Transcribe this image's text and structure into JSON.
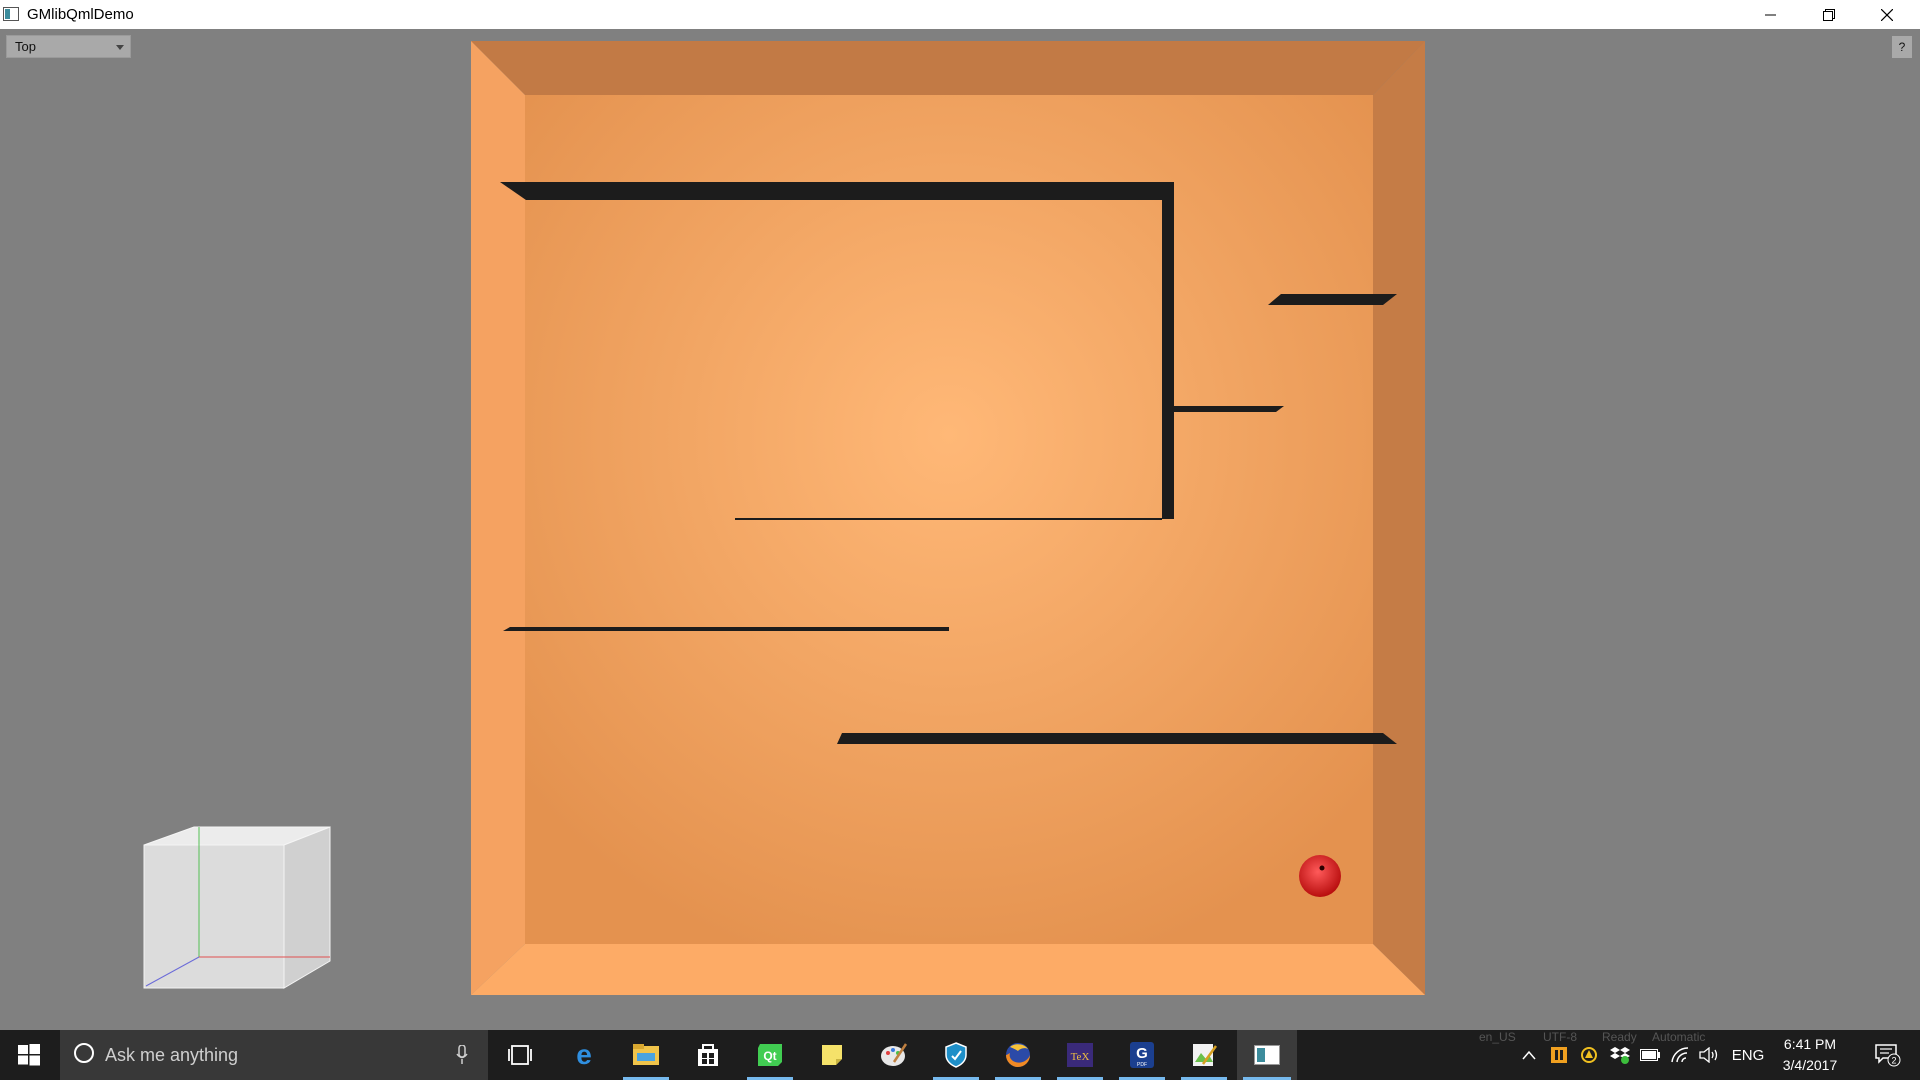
{
  "window": {
    "title": "GMlibQmlDemo",
    "controls": [
      "minimize-icon",
      "restore-icon",
      "close-icon"
    ]
  },
  "toolbar": {
    "view_select_value": "Top",
    "help_label": "?"
  },
  "colors": {
    "background": "#808080",
    "board_center": "#ffb877",
    "board_edge": "#e4924f",
    "wall_top": "#c27a45",
    "wall_left": "#f5a261",
    "wall_right": "#c57c46",
    "wall_bottom": "#fdab66",
    "maze_walls": "#1c1c1c",
    "ball": "#e02020"
  },
  "taskbar": {
    "search_placeholder": "Ask me anything",
    "apps": [
      "task-view-icon",
      "edge-icon",
      "file-explorer-icon",
      "store-icon",
      "qt-creator-icon",
      "sticky-notes-icon",
      "paint-icon",
      "defender-icon",
      "firefox-icon",
      "texmaker-icon",
      "pdf-icon",
      "image-viewer-icon",
      "gmlib-demo-icon"
    ],
    "faded_status": [
      "en_US",
      "UTF-8",
      "Ready",
      "Automatic"
    ],
    "language": "ENG",
    "time": "6:41 PM",
    "date": "3/4/2017",
    "notification_count": "2"
  }
}
